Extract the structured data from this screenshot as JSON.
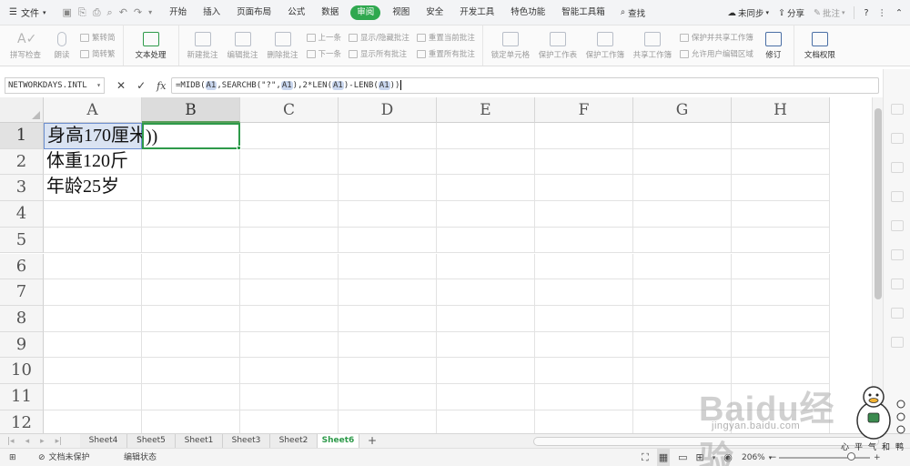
{
  "menu": {
    "file_label": "文件",
    "tabs": [
      "开始",
      "插入",
      "页面布局",
      "公式",
      "数据",
      "审阅",
      "视图",
      "安全",
      "开发工具",
      "特色功能",
      "智能工具箱"
    ],
    "active_tab": "审阅",
    "search_label": "查找",
    "sync_label": "未同步",
    "share_label": "分享",
    "comment_label": "批注"
  },
  "ribbon": {
    "spellcheck": "拼写检查",
    "read_aloud": "朗读",
    "trad_to_simp": "繁转简",
    "simp_to_trad": "简转繁",
    "text_processing": "文本处理",
    "new_comment": "新建批注",
    "edit_comment": "编辑批注",
    "delete_comment": "删除批注",
    "prev_item": "上一条",
    "next_item": "下一条",
    "show_hide_comment": "显示/隐藏批注",
    "show_all_comments": "显示所有批注",
    "reset_current_comment": "重置当前批注",
    "reset_all_comments": "重置所有批注",
    "lock_cell": "锁定单元格",
    "protect_sheet": "保护工作表",
    "protect_workbook": "保护工作簿",
    "share_workbook": "共享工作簿",
    "protect_share_workbook": "保护并共享工作簿",
    "allow_edit_ranges": "允许用户编辑区域",
    "revisions": "修订",
    "doc_permission": "文档权限"
  },
  "formula_bar": {
    "name_box": "NETWORKDAYS.INTL",
    "formula_parts": [
      {
        "text": "=MIDB(",
        "ref": false
      },
      {
        "text": "A1",
        "ref": true
      },
      {
        "text": ",SEARCHB(\"?\",",
        "ref": false
      },
      {
        "text": "A1",
        "ref": true
      },
      {
        "text": "),2*LEN(",
        "ref": false
      },
      {
        "text": "A1",
        "ref": true
      },
      {
        "text": ")-LENB(",
        "ref": false
      },
      {
        "text": "A1",
        "ref": true
      },
      {
        "text": "))",
        "ref": false
      }
    ]
  },
  "sheet": {
    "columns": [
      "A",
      "B",
      "C",
      "D",
      "E",
      "F",
      "G",
      "H"
    ],
    "rows": [
      "1",
      "2",
      "3",
      "4",
      "5",
      "6",
      "7",
      "8",
      "9",
      "10",
      "11",
      "12"
    ],
    "selected_column": "B",
    "selected_row": "1",
    "cells": {
      "A1": "身高170厘米",
      "A2": "体重120斤",
      "A3": "年龄25岁",
      "B1": "))"
    }
  },
  "sheet_tabs": [
    "Sheet4",
    "Sheet5",
    "Sheet1",
    "Sheet3",
    "Sheet2",
    "Sheet6"
  ],
  "active_sheet": "Sheet6",
  "status": {
    "doc_unprotected": "文档未保护",
    "edit_state": "编辑状态",
    "zoom": "206%"
  },
  "watermark": {
    "brand": "Baidu经验",
    "url": "jingyan.baidu.com",
    "author": "心平气和鸭"
  },
  "colors": {
    "active_tab_bg": "#2fa84f",
    "selection_border": "#2e9a4a",
    "ref_highlight": "#c9d6ee",
    "active_sheet_text": "#2e9a4a"
  }
}
